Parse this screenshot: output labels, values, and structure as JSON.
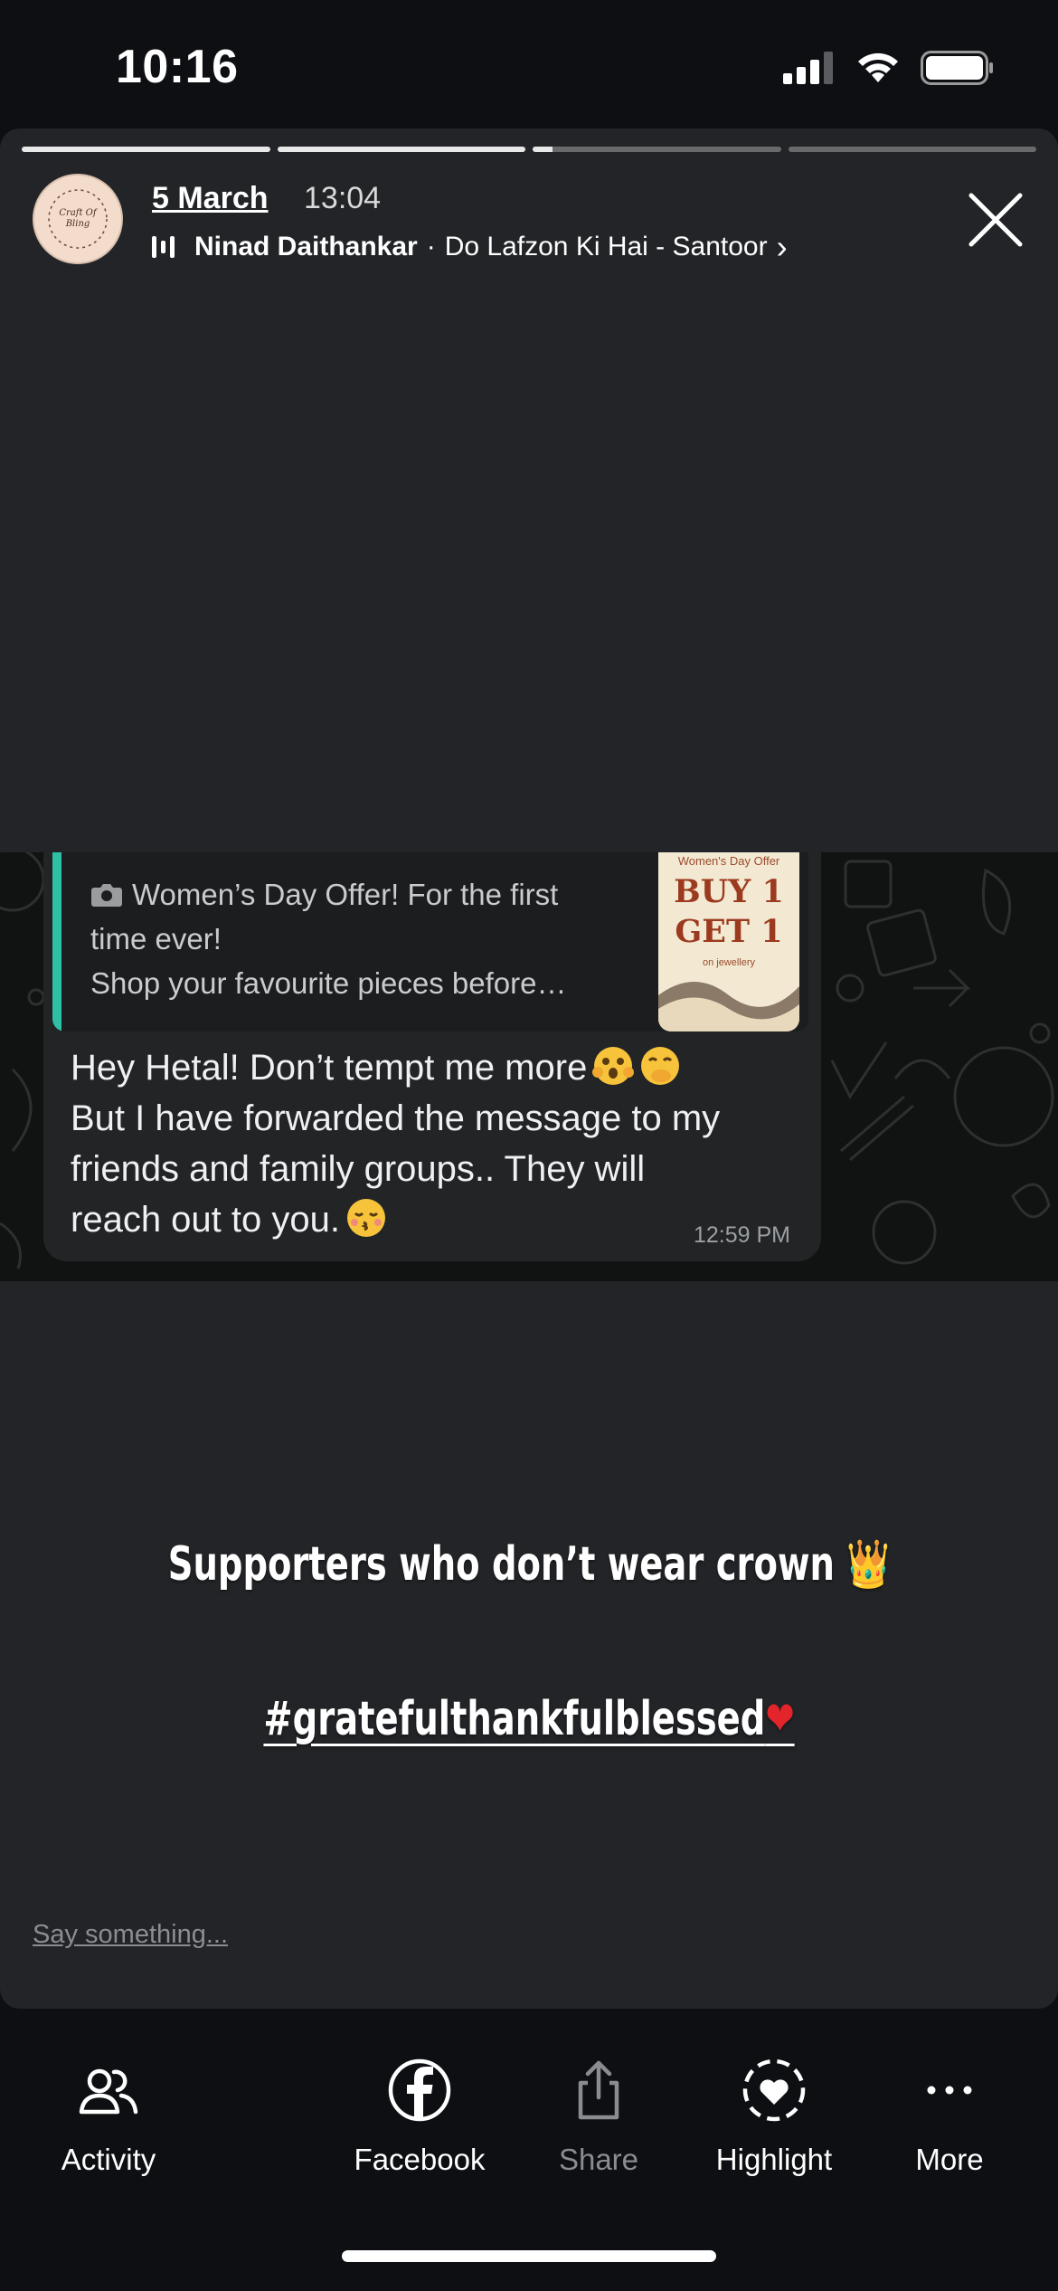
{
  "status_bar": {
    "time": "10:16",
    "icons": [
      "cellular-signal-icon",
      "wifi-icon",
      "battery-icon"
    ]
  },
  "story": {
    "progress_segments": [
      1,
      1,
      0.08,
      0
    ],
    "header": {
      "avatar_text": "Craft Of Bling",
      "date": "5 March",
      "time": "13:04",
      "music_artist": "Ninad Daithankar",
      "music_separator": "·",
      "music_track": "Do Lafzon Ki Hai - Santoor",
      "music_chevron": "›"
    },
    "chat": {
      "quoted": {
        "lines": [
          "Women’s Day Offer! For the first",
          "time ever!",
          "Shop your favourite pieces before…"
        ],
        "thumb_header": "Women's Day Offer",
        "thumb_big_1": "BUY 1",
        "thumb_big_2": "GET 1",
        "thumb_sub": "on jewellery"
      },
      "message_lines": [
        "Hey Hetal! Don’t tempt me more",
        "But I have forwarded the message to my",
        "friends and family groups.. They will",
        "reach out to you."
      ],
      "message_time": "12:59 PM"
    },
    "caption_1": "Supporters who don’t wear crown",
    "caption_1_emoji": "👑",
    "caption_2": "#gratefulthankfulblessed",
    "caption_2_emoji": "❤",
    "say_something": "Say something..."
  },
  "actions": [
    {
      "label": "Activity",
      "icon": "activity-people-icon"
    },
    {
      "label": "Facebook",
      "icon": "facebook-icon"
    },
    {
      "label": "Share",
      "icon": "share-icon",
      "disabled": true
    },
    {
      "label": "Highlight",
      "icon": "highlight-heart-icon"
    },
    {
      "label": "More",
      "icon": "more-dots-icon"
    }
  ],
  "colors": {
    "background": "#0d0f13",
    "story_bg": "#222427",
    "quote_accent": "#2fbfa5",
    "heart": "#e3242b",
    "crown": "#f5b82e"
  }
}
